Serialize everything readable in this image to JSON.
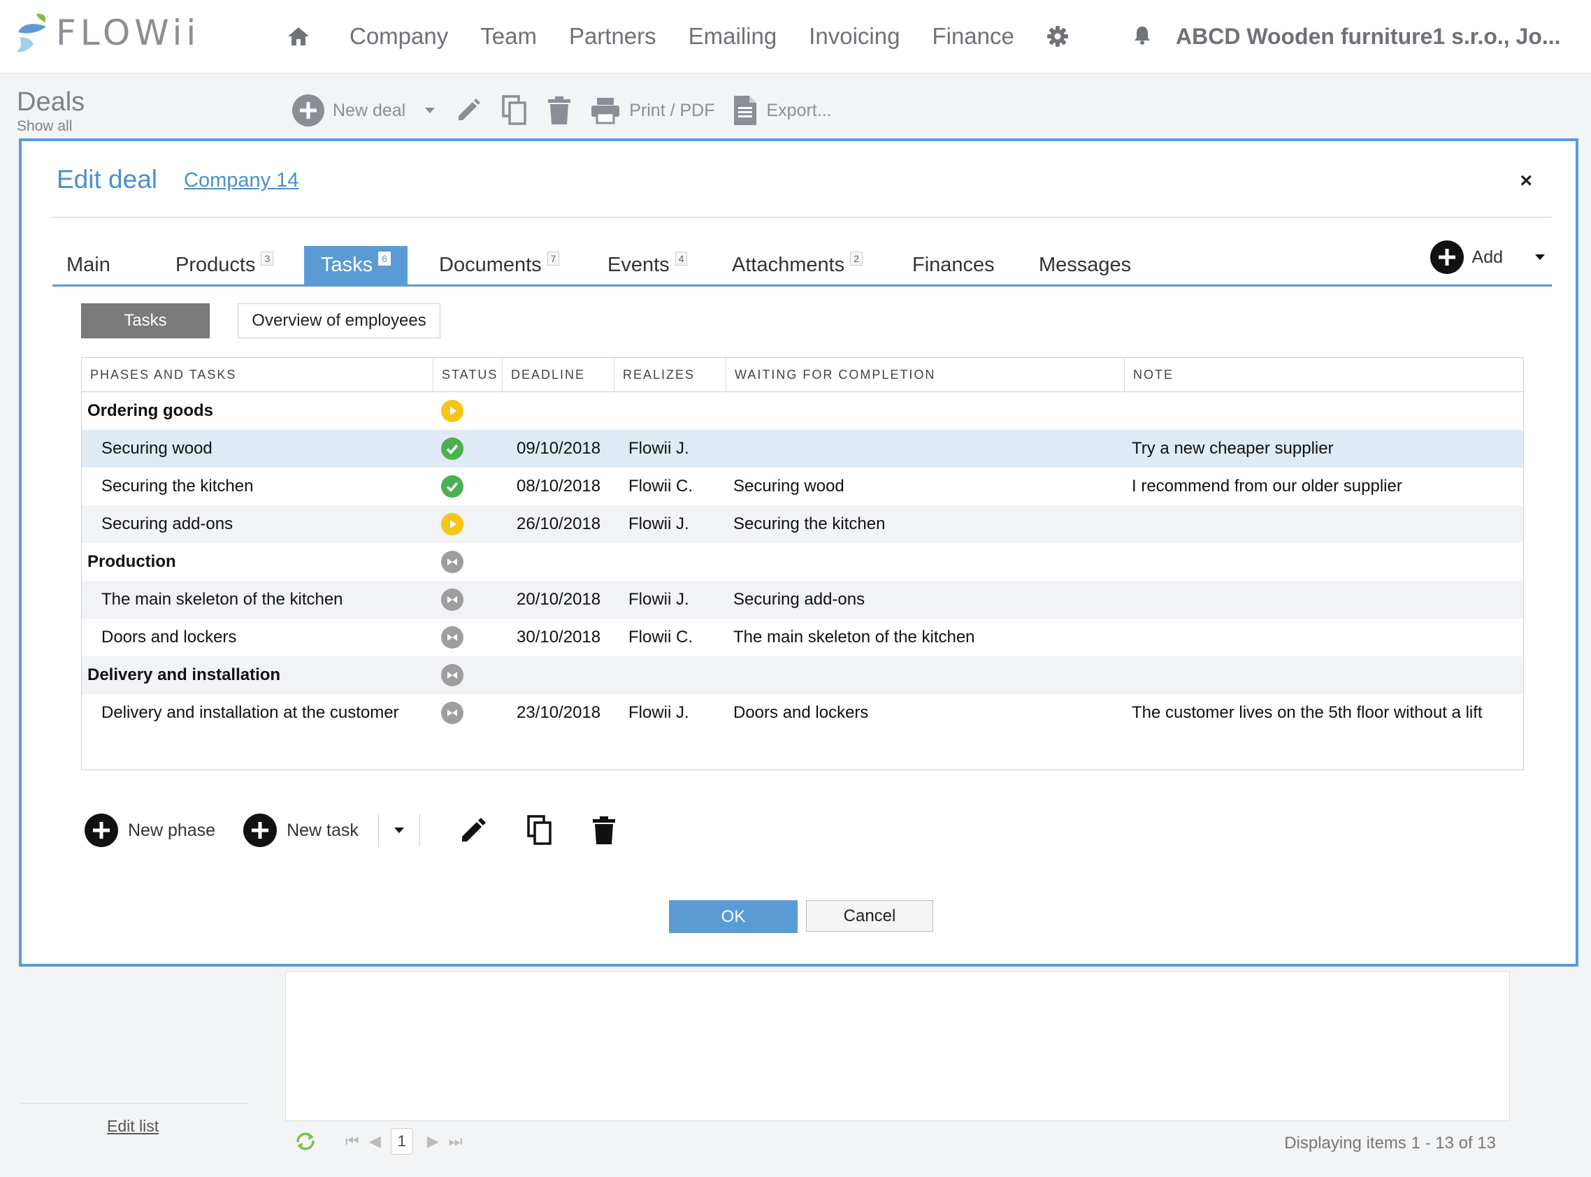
{
  "app": {
    "logo_text": "FLOWii"
  },
  "nav": {
    "items": [
      "Company",
      "Team",
      "Partners",
      "Emailing",
      "Invoicing",
      "Finance"
    ],
    "account": "ABCD Wooden furniture1 s.r.o., Jo..."
  },
  "page": {
    "title": "Deals",
    "subtitle": "Show all"
  },
  "toolbar": {
    "new_deal": "New deal",
    "print": "Print / PDF",
    "export": "Export..."
  },
  "dialog": {
    "title": "Edit deal",
    "company_link": "Company 14",
    "close": "×",
    "tabs": [
      {
        "label": "Main",
        "count": ""
      },
      {
        "label": "Products",
        "count": "3"
      },
      {
        "label": "Tasks",
        "count": "6"
      },
      {
        "label": "Documents",
        "count": "7"
      },
      {
        "label": "Events",
        "count": "4"
      },
      {
        "label": "Attachments",
        "count": "2"
      },
      {
        "label": "Finances",
        "count": ""
      },
      {
        "label": "Messages",
        "count": ""
      }
    ],
    "add_label": "Add",
    "subtabs": [
      "Tasks",
      "Overview of employees"
    ],
    "columns": [
      "PHASES AND TASKS",
      "STATUS",
      "DEADLINE",
      "REALIZES",
      "WAITING FOR COMPLETION",
      "NOTE"
    ],
    "rows": [
      {
        "name": "Ordering goods",
        "phase": true,
        "status": "in-progress",
        "deadline": "",
        "realizes": "",
        "waiting": "",
        "note": ""
      },
      {
        "name": "Securing wood",
        "phase": false,
        "status": "done",
        "deadline": "09/10/2018",
        "realizes": "Flowii J.",
        "waiting": "",
        "note": "Try a new cheaper supplier"
      },
      {
        "name": "Securing the kitchen",
        "phase": false,
        "status": "done",
        "deadline": "08/10/2018",
        "realizes": "Flowii C.",
        "waiting": "Securing wood",
        "note": "I recommend from our older supplier"
      },
      {
        "name": "Securing add-ons",
        "phase": false,
        "status": "in-progress",
        "deadline": "26/10/2018",
        "realizes": "Flowii J.",
        "waiting": "Securing the kitchen",
        "note": ""
      },
      {
        "name": "Production",
        "phase": true,
        "status": "waiting",
        "deadline": "",
        "realizes": "",
        "waiting": "",
        "note": ""
      },
      {
        "name": "The main skeleton of the kitchen",
        "phase": false,
        "status": "waiting",
        "deadline": "20/10/2018",
        "realizes": "Flowii J.",
        "waiting": "Securing add-ons",
        "note": ""
      },
      {
        "name": "Doors and lockers",
        "phase": false,
        "status": "waiting",
        "deadline": "30/10/2018",
        "realizes": "Flowii C.",
        "waiting": "The main skeleton of the kitchen",
        "note": ""
      },
      {
        "name": "Delivery and installation",
        "phase": true,
        "status": "waiting",
        "deadline": "",
        "realizes": "",
        "waiting": "",
        "note": ""
      },
      {
        "name": "Delivery and installation at the customer",
        "phase": false,
        "status": "waiting",
        "deadline": "23/10/2018",
        "realizes": "Flowii J.",
        "waiting": "Doors and lockers",
        "note": "The customer lives on the 5th floor without a lift"
      }
    ],
    "new_phase": "New phase",
    "new_task": "New task",
    "ok": "OK",
    "cancel": "Cancel"
  },
  "list": {
    "edit_list": "Edit list",
    "page_number": "1",
    "displaying": "Displaying items 1 - 13 of 13"
  },
  "colors": {
    "accent": "#5b9bd5",
    "done": "#4caf50",
    "in_progress": "#f5c518",
    "waiting": "#9e9e9e",
    "row_selected": "#dfeaf4",
    "row_alt": "#f1f3f6"
  }
}
